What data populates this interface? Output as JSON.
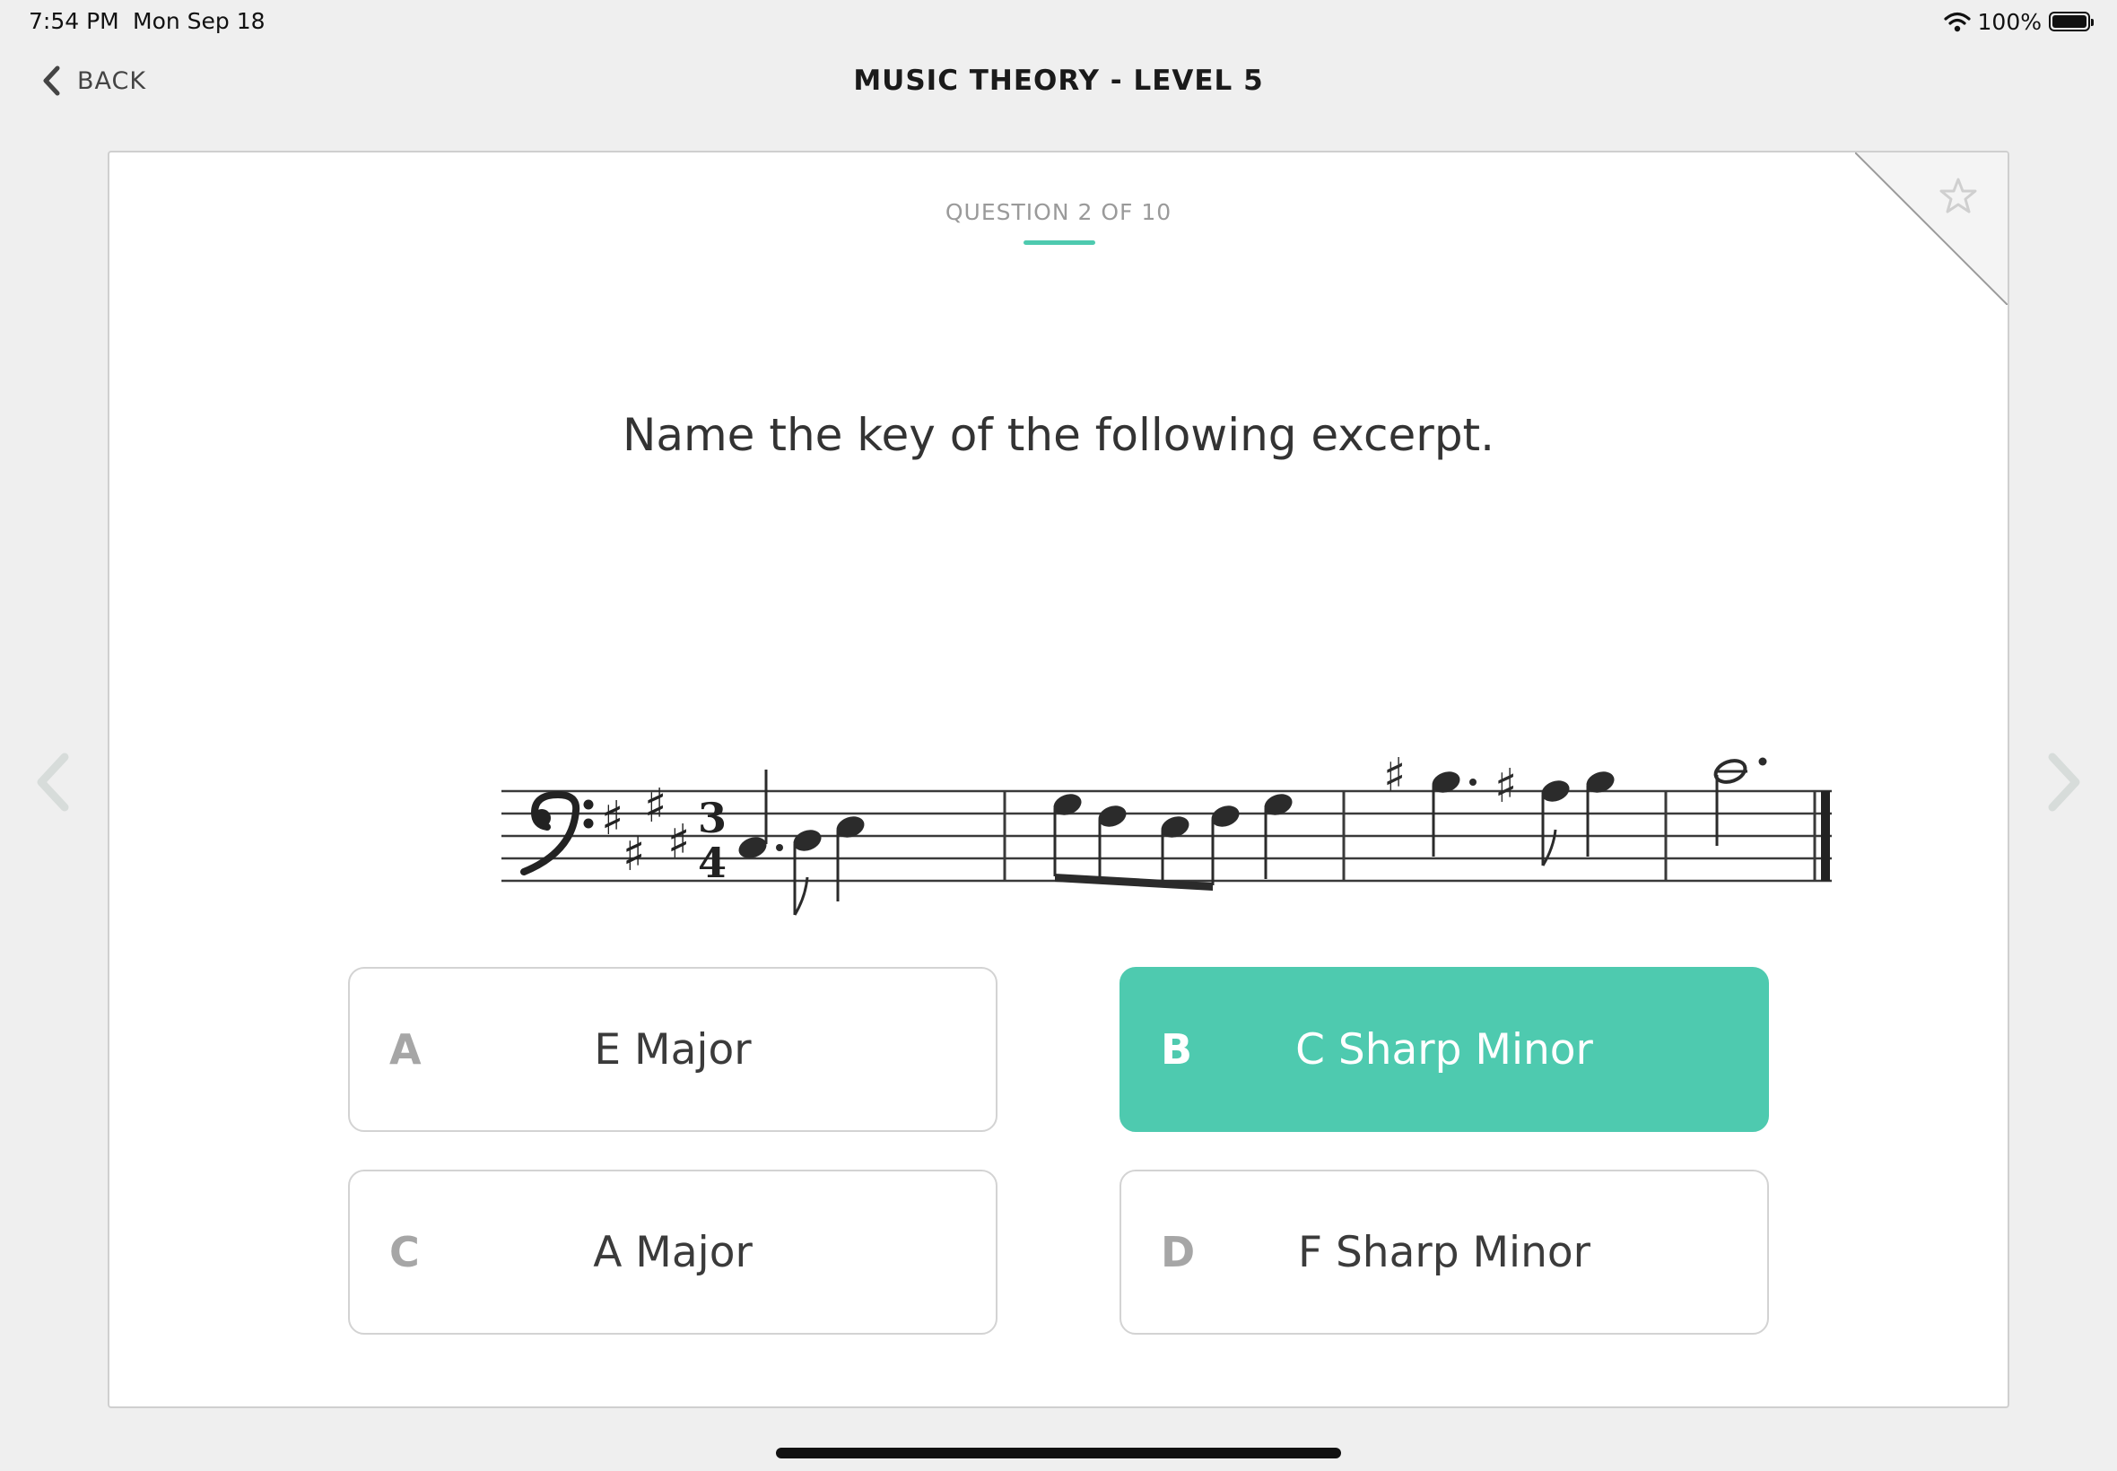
{
  "status_bar": {
    "time": "7:54 PM",
    "date": "Mon Sep 18",
    "battery": "100%",
    "battery_level": 1.0
  },
  "nav": {
    "back_label": "BACK",
    "title": "MUSIC THEORY - LEVEL 5"
  },
  "question": {
    "counter": "QUESTION 2 OF 10",
    "prompt": "Name the key of the following excerpt."
  },
  "answers": [
    {
      "letter": "A",
      "text": "E Major",
      "selected": false
    },
    {
      "letter": "B",
      "text": "C Sharp Minor",
      "selected": true
    },
    {
      "letter": "C",
      "text": "A Major",
      "selected": false
    },
    {
      "letter": "D",
      "text": "F Sharp Minor",
      "selected": false
    }
  ],
  "colors": {
    "accent": "#4ecaaf",
    "background": "#efefef",
    "card": "#ffffff"
  },
  "icons": {
    "back": "chevron-left-icon",
    "favorite": "star-outline-icon",
    "prev": "chevron-left-icon",
    "next": "chevron-right-icon",
    "wifi": "wifi-icon",
    "battery": "battery-icon"
  },
  "music": {
    "clef": "bass",
    "key_signature": "4 sharps",
    "time_signature": "3/4"
  }
}
